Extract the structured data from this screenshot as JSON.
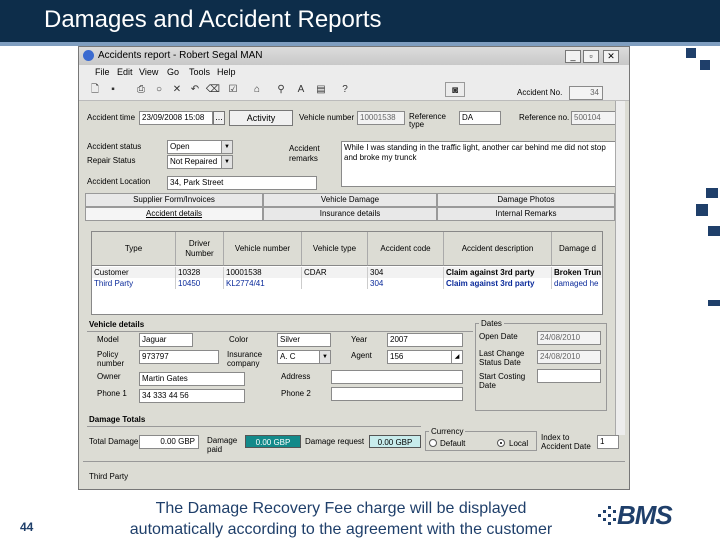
{
  "slide": {
    "title": "Damages and Accident Reports",
    "page_number": "44",
    "caption_line1": "The Damage Recovery Fee charge will be displayed",
    "caption_line2": "automatically according to the agreement with the customer",
    "logo_text": "BMS"
  },
  "window": {
    "title": "Accidents report - Robert Segal MAN",
    "menu": [
      "File",
      "Edit",
      "View",
      "Go",
      "Tools",
      "Help"
    ]
  },
  "header_fields": {
    "accident_date_label": "Accident time",
    "accident_date_value": "23/09/2008 15:08",
    "date_more": "...",
    "activity_button": "Activity",
    "vehicle_number_label": "Vehicle number",
    "vehicle_number_value": "10001538",
    "reference_type_label": "Reference type",
    "reference_type_value": "DA",
    "reference_no_label": "Reference no.",
    "reference_no_value": "500104",
    "accident_no_label": "Accident No.",
    "accident_no_value": "34"
  },
  "status_fields": {
    "accident_status_label": "Accident status",
    "accident_status_value": "Open",
    "repair_status_label": "Repair Status",
    "repair_status_value": "Not Repaired",
    "accident_location_label": "Accident Location",
    "accident_location_value": "34, Park Street",
    "remarks_label": "Accident remarks",
    "remarks_value": "While I was standing in the traffic light, another car behind me did not stop and broke my trunck"
  },
  "tabs_top": [
    "Supplier Form/Invoices",
    "Vehicle Damage",
    "Damage Photos"
  ],
  "tabs_bottom": [
    "Accident details",
    "Insurance details",
    "Internal Remarks"
  ],
  "grid": {
    "columns": [
      "Type",
      "Driver Number",
      "Vehicle number",
      "Vehicle type",
      "Accident code",
      "Accident description",
      "Damage d"
    ],
    "rows": [
      {
        "type": "Customer",
        "driver": "10328",
        "vehicle": "10001538",
        "vtype": "CDAR",
        "code": "304",
        "description": "Claim against 3rd party",
        "damage": "Broken Trun"
      },
      {
        "type": "Third Party",
        "driver": "10450",
        "vehicle": "KL2774/41",
        "vtype": "",
        "code": "304",
        "description": "Claim against 3rd party",
        "damage": "damaged he"
      }
    ]
  },
  "vehicle_details": {
    "section_label": "Vehicle details",
    "model_label": "Model",
    "model_value": "Jaguar",
    "color_label": "Color",
    "color_value": "Silver",
    "year_label": "Year",
    "year_value": "2007",
    "policy_label": "Policy number",
    "policy_value": "973797",
    "insurance_label": "Insurance company",
    "insurance_value": "A. C",
    "agent_label": "Agent",
    "agent_value": "156",
    "owner_label": "Owner",
    "owner_value": "Martin Gates",
    "address_label": "Address",
    "address_value": "",
    "phone1_label": "Phone 1",
    "phone1_value": "34 333 44 56",
    "phone2_label": "Phone 2",
    "phone2_value": ""
  },
  "dates": {
    "section_label": "Dates",
    "open_label": "Open Date",
    "open_value": "24/08/2010",
    "last_change_label": "Last Change Status Date",
    "last_change_value": "24/08/2010",
    "start_costing_label": "Start Costing Date",
    "start_costing_value": ""
  },
  "damage_totals": {
    "section_label": "Damage Totals",
    "total_label": "Total Damage",
    "total_value": "0.00 GBP",
    "paid_label": "Damage paid",
    "paid_value": "0.00 GBP",
    "request_label": "Damage request",
    "request_value": "0.00 GBP",
    "currency_label": "Currency",
    "currency_default": "Default",
    "currency_local": "Local",
    "index_label": "Index to Accident Date",
    "index_value": "1"
  },
  "bottom": {
    "third_party_label": "Third Party"
  },
  "colors": {
    "header_bg": "#0d2d4a",
    "paid_gauge": "#138a8a",
    "request_gauge": "#c8ecec",
    "brand_blue": "#1f3f6a"
  }
}
